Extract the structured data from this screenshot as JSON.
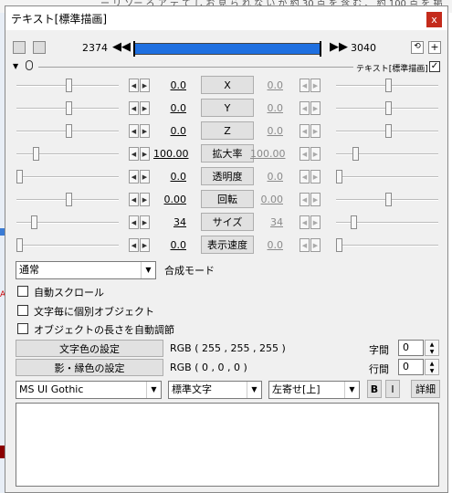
{
  "background_text": "ー リ ソー ろ ア テ て し お 見 ら れ な い が 約 30 点 を 含 む 、 約 100 点 を 掲 載 し よ",
  "window": {
    "title": "テキスト[標準描画]",
    "close": "x"
  },
  "timeline": {
    "start_frame": "2374",
    "end_frame": "3040",
    "rewind": "◀◀",
    "forward": "▶▶"
  },
  "section": {
    "label": "テキスト[標準描画]",
    "collapse": "▼"
  },
  "params": [
    {
      "label": "X",
      "left_value": "0.0",
      "right_value": "0.0",
      "left_level": 0.5,
      "right_level": 0.5
    },
    {
      "label": "Y",
      "left_value": "0.0",
      "right_value": "0.0",
      "left_level": 0.5,
      "right_level": 0.5
    },
    {
      "label": "Z",
      "left_value": "0.0",
      "right_value": "0.0",
      "left_level": 0.5,
      "right_level": 0.5
    },
    {
      "label": "拡大率",
      "left_value": "100.00",
      "right_value": "100.00",
      "left_level": 0.17,
      "right_level": 0.17
    },
    {
      "label": "透明度",
      "left_value": "0.0",
      "right_value": "0.0",
      "left_level": 0.0,
      "right_level": 0.0
    },
    {
      "label": "回転",
      "left_value": "0.00",
      "right_value": "0.00",
      "left_level": 0.5,
      "right_level": 0.5
    },
    {
      "label": "サイズ",
      "left_value": "34",
      "right_value": "34",
      "left_level": 0.15,
      "right_level": 0.15
    },
    {
      "label": "表示速度",
      "left_value": "0.0",
      "right_value": "0.0",
      "left_level": 0.0,
      "right_level": 0.0
    }
  ],
  "blend": {
    "value": "通常",
    "label": "合成モード"
  },
  "checkboxes": [
    {
      "label": "自動スクロール"
    },
    {
      "label": "文字毎に個別オブジェクト"
    },
    {
      "label": "オブジェクトの長さを自動調節"
    }
  ],
  "color": {
    "text_button": "文字色の設定",
    "text_rgb": "RGB ( 255 , 255 , 255 )",
    "shadow_button": "影・縁色の設定",
    "shadow_rgb": "RGB ( 0 , 0 , 0 )"
  },
  "spacing": {
    "char_label": "字間",
    "char_value": "0",
    "line_label": "行間",
    "line_value": "0"
  },
  "font": {
    "name": "MS UI Gothic",
    "style": "標準文字",
    "align": "左寄せ[上]",
    "bold": "B",
    "italic": "I",
    "detail": "詳細"
  },
  "text_content": ""
}
